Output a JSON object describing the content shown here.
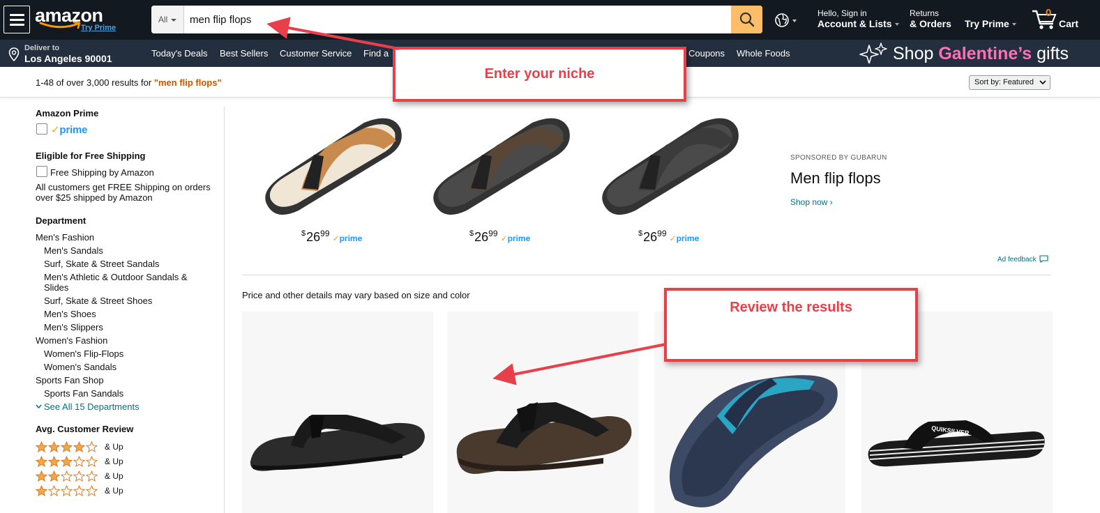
{
  "nav": {
    "logo_text": "amazon",
    "logo_sub": "Try Prime",
    "search_dept": "All",
    "search_value": "men flip flops",
    "account_l1": "Hello, Sign in",
    "account_l2": "Account & Lists",
    "returns_l1": "Returns",
    "returns_l2": "& Orders",
    "prime_label": "Try Prime",
    "cart_count": "0",
    "cart_label": "Cart"
  },
  "subnav": {
    "deliver_l1": "Deliver to",
    "deliver_l2": "Los Angeles 90001",
    "items": [
      "Today's Deals",
      "Best Sellers",
      "Customer Service",
      "Find a",
      "Coupons",
      "Whole Foods"
    ],
    "promo_prefix": "Shop ",
    "promo_highlight": "Galentine’s",
    "promo_suffix": " gifts"
  },
  "results": {
    "count_text": "1-48 of over 3,000 results for ",
    "query_text": "\"men flip flops\"",
    "sort_label": "Sort by:",
    "sort_value": "Featured"
  },
  "sidebar": {
    "prime_heading": "Amazon Prime",
    "prime_label": "prime",
    "shipping_heading": "Eligible for Free Shipping",
    "shipping_option": "Free Shipping by Amazon",
    "shipping_note_1": "All customers get FREE Shipping on orders",
    "shipping_note_2": "over $25 shipped by Amazon",
    "dept_heading": "Department",
    "departments": [
      "Men's Fashion",
      "Men's Sandals",
      "Surf, Skate & Street Sandals",
      "Men's Athletic & Outdoor Sandals &",
      "Slides",
      "Surf, Skate & Street Shoes",
      "Men's Shoes",
      "Men's Slippers",
      "Women's Fashion",
      "Women's Flip-Flops",
      "Women's Sandals",
      "Sports Fan Shop",
      "Sports Fan Sandals"
    ],
    "see_all": "See All 15 Departments",
    "review_heading": "Avg. Customer Review",
    "review_rows": [
      {
        "stars": 4,
        "label": "& Up"
      },
      {
        "stars": 3,
        "label": "& Up"
      },
      {
        "stars": 2,
        "label": "& Up"
      },
      {
        "stars": 1,
        "label": "& Up"
      }
    ]
  },
  "sponsored": {
    "products": [
      {
        "price_symbol": "$",
        "price_whole": "26",
        "price_frac": "99",
        "prime": "prime",
        "color": "#c98b4d"
      },
      {
        "price_symbol": "$",
        "price_whole": "26",
        "price_frac": "99",
        "prime": "prime",
        "color": "#5a4636"
      },
      {
        "price_symbol": "$",
        "price_whole": "26",
        "price_frac": "99",
        "prime": "prime",
        "color": "#3b3b3b"
      }
    ],
    "sponsored_by": "SPONSORED BY GUBARUN",
    "title": "Men flip flops",
    "shop_now": "Shop now ›",
    "ad_feedback": "Ad feedback"
  },
  "main": {
    "disclaimer": "Price and other details may vary based on size and color"
  },
  "callouts": {
    "niche": "Enter your niche",
    "results": "Review the results"
  },
  "colors": {
    "nav_bg": "#131921",
    "subnav_bg": "#232f3e",
    "search_btn": "#febd69",
    "callout_red": "#e8404a",
    "link_teal": "#007185",
    "star_gold": "#f3a847"
  }
}
